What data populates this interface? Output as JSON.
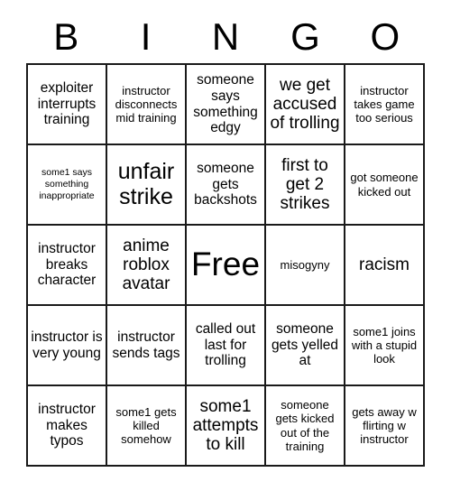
{
  "card": {
    "header_letters": [
      "B",
      "I",
      "N",
      "G",
      "O"
    ],
    "rows": [
      [
        {
          "text": "exploiter interrupts training",
          "size": "md"
        },
        {
          "text": "instructor disconnects mid training",
          "size": "sm"
        },
        {
          "text": "someone says something edgy",
          "size": "md"
        },
        {
          "text": "we get accused of trolling",
          "size": "lg"
        },
        {
          "text": "instructor takes game too serious",
          "size": "sm"
        }
      ],
      [
        {
          "text": "some1 says something inappropriate",
          "size": "xs"
        },
        {
          "text": "unfair strike",
          "size": "xl"
        },
        {
          "text": "someone gets backshots",
          "size": "md"
        },
        {
          "text": "first to get 2 strikes",
          "size": "lg"
        },
        {
          "text": "got someone kicked out",
          "size": "sm"
        }
      ],
      [
        {
          "text": "instructor breaks character",
          "size": "md"
        },
        {
          "text": "anime roblox avatar",
          "size": "lg"
        },
        {
          "text": "Free",
          "size": "xxl"
        },
        {
          "text": "misogyny",
          "size": "sm"
        },
        {
          "text": "racism",
          "size": "lg"
        }
      ],
      [
        {
          "text": "instructor is very young",
          "size": "md"
        },
        {
          "text": "instructor sends tags",
          "size": "md"
        },
        {
          "text": "called out last for trolling",
          "size": "md"
        },
        {
          "text": "someone gets yelled at",
          "size": "md"
        },
        {
          "text": "some1 joins with a stupid look",
          "size": "sm"
        }
      ],
      [
        {
          "text": "instructor makes typos",
          "size": "md"
        },
        {
          "text": "some1 gets killed somehow",
          "size": "sm"
        },
        {
          "text": "some1 attempts to kill",
          "size": "lg"
        },
        {
          "text": "someone gets kicked out of the training",
          "size": "sm"
        },
        {
          "text": "gets away w flirting w instructor",
          "size": "sm"
        }
      ]
    ]
  },
  "colors": {
    "border": "#1a1a1a",
    "background": "#ffffff",
    "text": "#000000"
  }
}
